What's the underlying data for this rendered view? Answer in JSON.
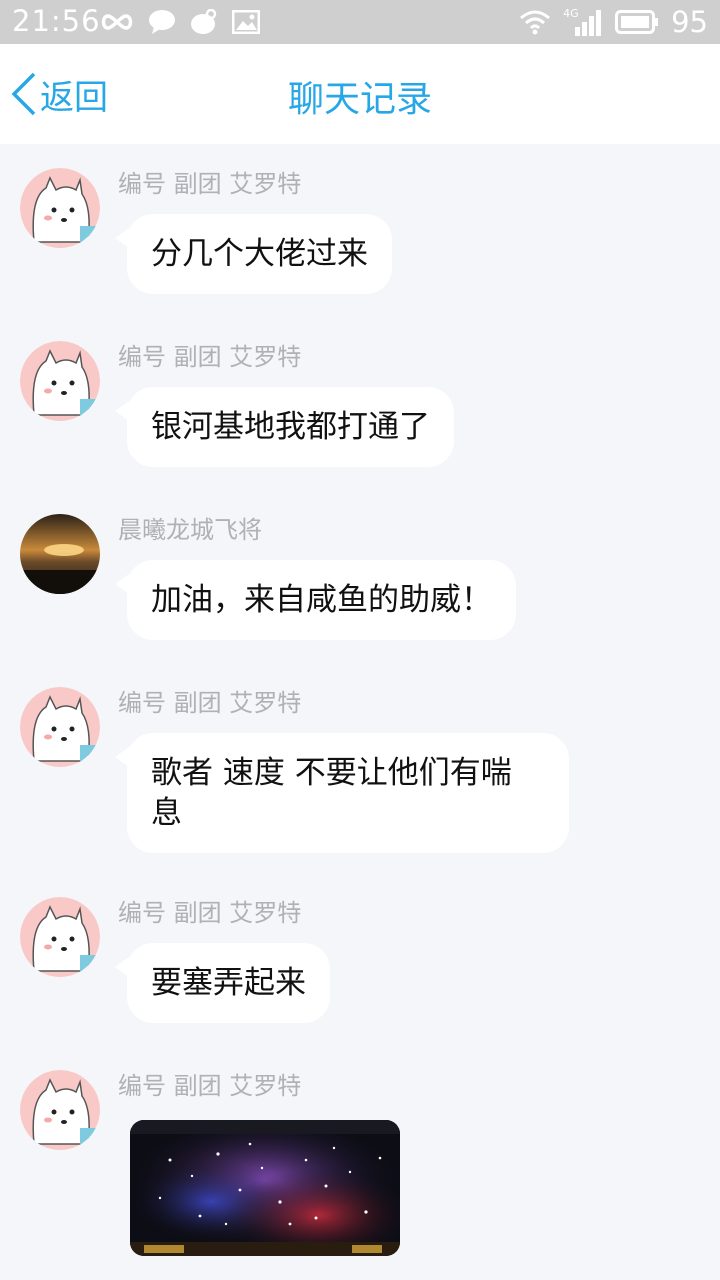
{
  "status_bar": {
    "time": "21:56",
    "network": "4G",
    "battery": "95",
    "icons_left": [
      "infinity-icon",
      "chat-icon",
      "weibo-icon",
      "image-icon"
    ],
    "icons_right": [
      "wifi-icon",
      "signal-icon",
      "battery-icon"
    ]
  },
  "header": {
    "back_label": "返回",
    "title": "聊天记录",
    "accent_color": "#28a7e6"
  },
  "messages": [
    {
      "sender": "编号 副团 艾罗特",
      "text": "分几个大佬过来",
      "avatar": "cartoon-dog-avatar"
    },
    {
      "sender": "编号 副团 艾罗特",
      "text": "银河基地我都打通了",
      "avatar": "cartoon-dog-avatar"
    },
    {
      "sender": "晨曦龙城飞将",
      "text": "加油，来自咸鱼的助威！",
      "avatar": "sunset-avatar"
    },
    {
      "sender": "编号 副团 艾罗特",
      "text_line1": "歌者 速度  不要让他们有喘",
      "text_line2": "息",
      "avatar": "cartoon-dog-avatar"
    },
    {
      "sender": "编号 副团 艾罗特",
      "text": "要塞弄起来",
      "avatar": "cartoon-dog-avatar"
    },
    {
      "sender": "编号 副团 艾罗特",
      "image": "game-screenshot-thumbnail",
      "avatar": "cartoon-dog-avatar"
    }
  ]
}
